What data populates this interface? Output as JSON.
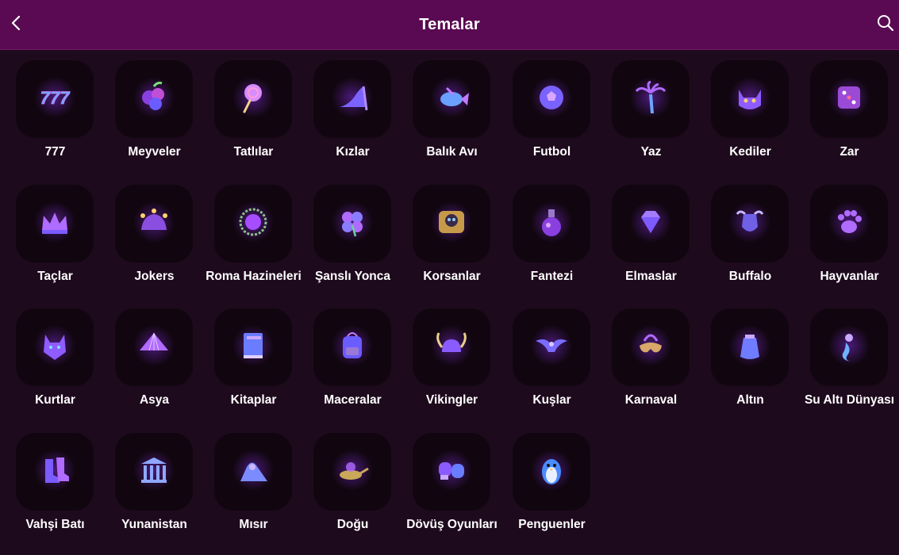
{
  "header": {
    "title": "Temalar"
  },
  "icons": {
    "back": "chevron-left-icon",
    "search": "search-icon"
  },
  "colors": {
    "header_bg": "#5a0a52",
    "page_bg": "#1e0a1d",
    "tile_bg": "#11060f",
    "accent": "#a64dff"
  },
  "themes": [
    {
      "label": "777",
      "icon": "sevens"
    },
    {
      "label": "Meyveler",
      "icon": "fruits"
    },
    {
      "label": "Tatlılar",
      "icon": "lollipop"
    },
    {
      "label": "Kızlar",
      "icon": "high-heel"
    },
    {
      "label": "Balık Avı",
      "icon": "fish"
    },
    {
      "label": "Futbol",
      "icon": "football"
    },
    {
      "label": "Yaz",
      "icon": "palm-tree"
    },
    {
      "label": "Kediler",
      "icon": "cat"
    },
    {
      "label": "Zar",
      "icon": "dice"
    },
    {
      "label": "Taçlar",
      "icon": "crown"
    },
    {
      "label": "Jokers",
      "icon": "jester-hat"
    },
    {
      "label": "Roma Hazineleri",
      "icon": "laurel-wreath"
    },
    {
      "label": "Şanslı Yonca",
      "icon": "clover"
    },
    {
      "label": "Korsanlar",
      "icon": "skull"
    },
    {
      "label": "Fantezi",
      "icon": "potion"
    },
    {
      "label": "Elmaslar",
      "icon": "diamond"
    },
    {
      "label": "Buffalo",
      "icon": "buffalo"
    },
    {
      "label": "Hayvanlar",
      "icon": "paw"
    },
    {
      "label": "Kurtlar",
      "icon": "wolf"
    },
    {
      "label": "Asya",
      "icon": "asian-hat"
    },
    {
      "label": "Kitaplar",
      "icon": "book"
    },
    {
      "label": "Maceralar",
      "icon": "backpack"
    },
    {
      "label": "Vikingler",
      "icon": "viking-helmet"
    },
    {
      "label": "Kuşlar",
      "icon": "eagle"
    },
    {
      "label": "Karnaval",
      "icon": "carnival-mask"
    },
    {
      "label": "Altın",
      "icon": "gold-bag"
    },
    {
      "label": "Su Altı Dünyası",
      "icon": "mermaid"
    },
    {
      "label": "Vahşi Batı",
      "icon": "cowboy-boots"
    },
    {
      "label": "Yunanistan",
      "icon": "greek-temple"
    },
    {
      "label": "Mısır",
      "icon": "sphinx"
    },
    {
      "label": "Doğu",
      "icon": "magic-lamp"
    },
    {
      "label": "Dövüş Oyunları",
      "icon": "boxing-gloves"
    },
    {
      "label": "Penguenler",
      "icon": "penguin"
    }
  ]
}
